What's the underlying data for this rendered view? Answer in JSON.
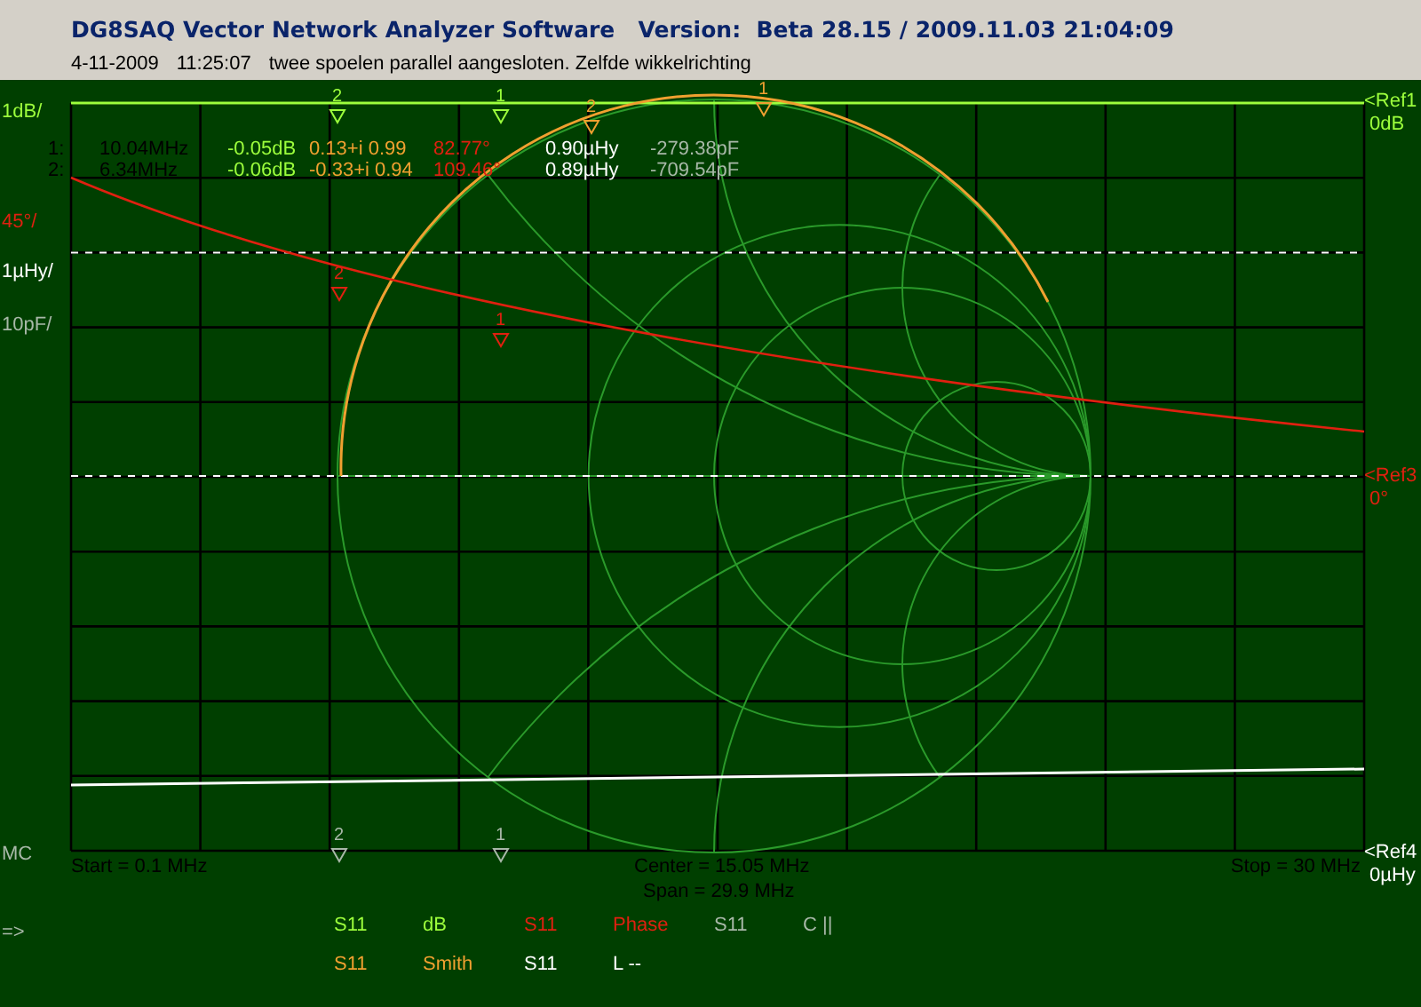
{
  "window": {
    "title": "DG8SAQ Vector Network Analyzer Software   Version:  Beta 28.15 / 2009.11.03 21:04:09"
  },
  "info_line": {
    "date": "4-11-2009",
    "time": "11:25:07",
    "comment": "twee spoelen parallel aangesloten. Zelfde wikkelrichting"
  },
  "scale_labels": [
    {
      "text": "1dB/",
      "kind": "db"
    },
    {
      "text": "45°/",
      "kind": "phase"
    },
    {
      "text": "1µHy/",
      "kind": "inductance"
    },
    {
      "text": "10pF/",
      "kind": "capacitance"
    },
    {
      "text": "MC",
      "kind": "mode"
    }
  ],
  "ref_labels": [
    {
      "arrow": "<Ref1",
      "value": "0dB",
      "kind": "db"
    },
    {
      "arrow": "<Ref3",
      "value": "0°",
      "kind": "phase"
    },
    {
      "arrow": "<Ref4",
      "value": "0µHy",
      "kind": "inductance"
    }
  ],
  "marker_readouts": [
    {
      "marker": "1:",
      "frequency": "10.04MHz",
      "db": "-0.05dB",
      "smith": "0.13+i 0.99",
      "phase": "82.77°",
      "inductance": "0.90µHy",
      "capacitance": "-279.38pF"
    },
    {
      "marker": "2:",
      "frequency": "6.34MHz",
      "db": "-0.06dB",
      "smith": "-0.33+i 0.94",
      "phase": "109.46°",
      "inductance": "0.89µHy",
      "capacitance": "-709.54pF"
    }
  ],
  "trace_markers": [
    {
      "label": "2",
      "kind": "db"
    },
    {
      "label": "1",
      "kind": "db"
    },
    {
      "label": "2",
      "kind": "smith"
    },
    {
      "label": "1",
      "kind": "smith"
    },
    {
      "label": "2",
      "kind": "phase"
    },
    {
      "label": "1",
      "kind": "phase"
    },
    {
      "label": "2",
      "kind": "capacitance"
    },
    {
      "label": "1",
      "kind": "capacitance"
    }
  ],
  "sweep": {
    "start": "Start = 0.1 MHz",
    "center": "Center = 15.05 MHz",
    "span": "Span = 29.9 MHz",
    "stop": "Stop = 30 MHz"
  },
  "cursor": "=>",
  "traces": [
    {
      "param": "S11",
      "format": "dB",
      "kind": "db"
    },
    {
      "param": "S11",
      "format": "Phase",
      "kind": "phase"
    },
    {
      "param": "S11",
      "format": "C ||",
      "kind": "capacitance"
    },
    {
      "param": "S11",
      "format": "Smith",
      "kind": "smith"
    },
    {
      "param": "S11",
      "format": "L --",
      "kind": "inductance"
    }
  ]
}
